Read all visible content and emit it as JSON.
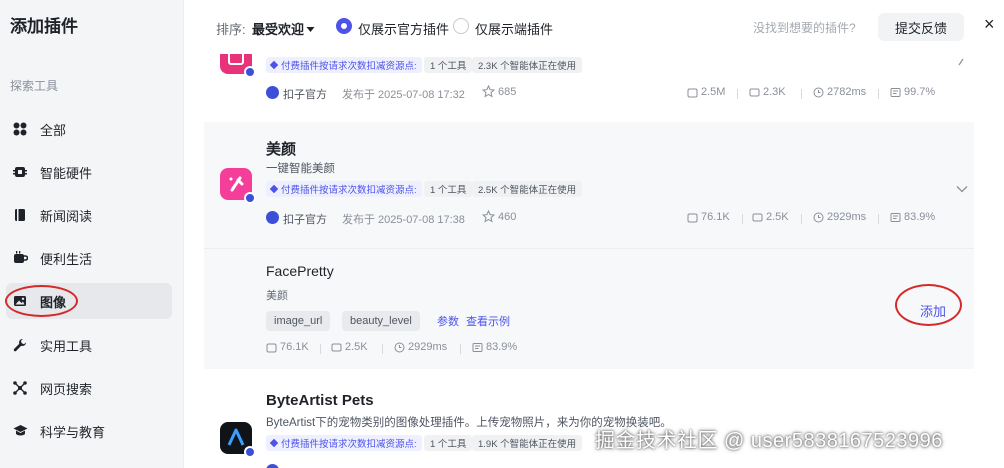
{
  "sidebar": {
    "title": "添加插件",
    "section": "探索工具",
    "items": [
      {
        "label": "全部",
        "icon": "grid-icon"
      },
      {
        "label": "智能硬件",
        "icon": "chip-icon"
      },
      {
        "label": "新闻阅读",
        "icon": "book-icon"
      },
      {
        "label": "便利生活",
        "icon": "cup-icon"
      },
      {
        "label": "图像",
        "icon": "image-icon",
        "active": true
      },
      {
        "label": "实用工具",
        "icon": "wrench-icon"
      },
      {
        "label": "网页搜索",
        "icon": "network-icon"
      },
      {
        "label": "科学与教育",
        "icon": "graduation-cap-icon"
      }
    ]
  },
  "topbar": {
    "sort_label": "排序:",
    "sort_value": "最受欢迎",
    "radio_official": "仅展示官方插件",
    "radio_client": "仅展示端插件",
    "not_found": "没找到想要的插件?",
    "feedback": "提交反馈",
    "close": "×"
  },
  "plugins": [
    {
      "pay_tag": "付费插件按请求次数扣减资源点:",
      "tools": "1 个工具",
      "agents": "2.3K 个智能体正在使用",
      "author": "扣子官方",
      "published": "发布于 2025-07-08 17:32",
      "stars": "685",
      "stat_calls": "2.5M",
      "stat_bots": "2.3K",
      "stat_time": "2782ms",
      "stat_rate": "99.7%"
    },
    {
      "name": "美颜",
      "desc": "一键智能美颜",
      "pay_tag": "付费插件按请求次数扣减资源点:",
      "tools": "1 个工具",
      "agents": "2.5K 个智能体正在使用",
      "author": "扣子官方",
      "published": "发布于 2025-07-08 17:38",
      "stars": "460",
      "stat_calls": "76.1K",
      "stat_bots": "2.5K",
      "stat_time": "2929ms",
      "stat_rate": "83.9%"
    },
    {
      "name": "ByteArtist Pets",
      "desc": "ByteArtist下的宠物类别的图像处理插件。上传宠物照片，来为你的宠物换装吧。",
      "pay_tag": "付费插件按请求次数扣减资源点:",
      "tools": "1 个工具",
      "agents": "1.9K 个智能体正在使用"
    }
  ],
  "tool": {
    "name": "FacePretty",
    "desc": "美颜",
    "params": [
      "image_url",
      "beauty_level"
    ],
    "link_params": "参数",
    "link_example": "查看示例",
    "add": "添加",
    "stat_calls": "76.1K",
    "stat_bots": "2.5K",
    "stat_time": "2929ms",
    "stat_rate": "83.9%"
  },
  "watermark": "掘金技术社区 @ user5838167523996",
  "colors": {
    "accent": "#4d53e8",
    "annotation": "#d42a2a"
  }
}
